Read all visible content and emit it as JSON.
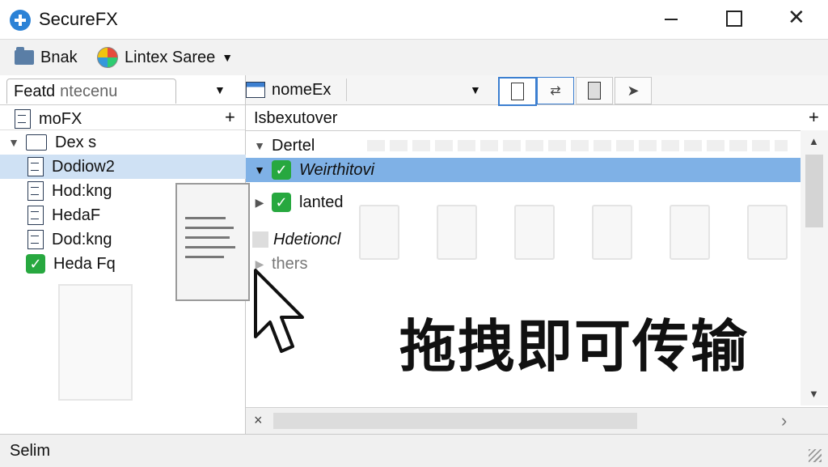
{
  "window": {
    "title": "SecureFX",
    "close_glyph": "✕"
  },
  "menubar": {
    "items": [
      {
        "label": "Bnak",
        "icon": "folder-icon"
      },
      {
        "label": "Lintex Saree",
        "icon": "globe-icon"
      }
    ]
  },
  "left_pane": {
    "tab_label": "Featd",
    "tab_sublabel": "ntecenu",
    "header_label": "moFX",
    "add_glyph": "+",
    "tree": [
      {
        "label": "Dex s",
        "icon": "folder-icon",
        "expanded": true,
        "selected": false
      },
      {
        "label": "Dodiow2",
        "icon": "file-icon",
        "selected": true
      },
      {
        "label": "Hod:kng",
        "icon": "file-icon",
        "selected": false
      },
      {
        "label": "HedaF",
        "icon": "file-icon",
        "selected": false
      },
      {
        "label": "Dod:kng",
        "icon": "file-icon",
        "selected": false
      },
      {
        "label": "Heda Fq",
        "icon": "check-icon",
        "selected": false
      }
    ]
  },
  "right_pane": {
    "session_label": "nomeEx",
    "path_value": "Isbexutover",
    "add_glyph": "+",
    "rows": [
      {
        "label": "Dertel",
        "expander": "▼",
        "icon": "",
        "selected": false,
        "italic": false
      },
      {
        "label": "Weirthitovi",
        "expander": "▼",
        "icon": "check-icon",
        "selected": true,
        "italic": true
      },
      {
        "label": "lanted",
        "expander": "▶",
        "icon": "check-icon",
        "selected": false,
        "italic": false
      },
      {
        "label": "Hdetioncl",
        "expander": "",
        "icon": "",
        "selected": false,
        "italic": true
      },
      {
        "label": "thers",
        "expander": "▶",
        "icon": "",
        "selected": false,
        "italic": false
      }
    ],
    "hscroll_left": "×",
    "hscroll_right": "›",
    "vscroll_up": "▲",
    "vscroll_down": "▼"
  },
  "banner": {
    "text": "拖拽即可传输"
  },
  "statusbar": {
    "text": "Selim"
  },
  "colors": {
    "selection": "#7fb1e6",
    "tree_selection": "#cfe1f4",
    "check": "#27a83f",
    "active_toolbar": "#3c7fd0"
  }
}
